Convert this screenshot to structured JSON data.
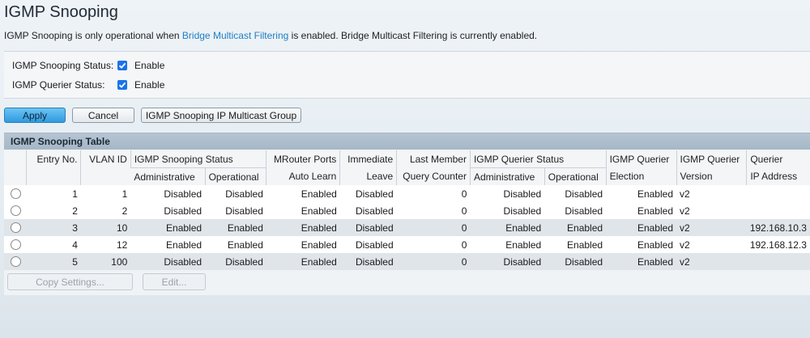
{
  "page": {
    "title": "IGMP Snooping",
    "desc_prefix": "IGMP Snooping is only operational when ",
    "desc_link": "Bridge Multicast Filtering",
    "desc_suffix": " is enabled. Bridge Multicast Filtering is currently enabled."
  },
  "status": {
    "snooping_label": "IGMP Snooping Status:",
    "snooping_checked": true,
    "snooping_text": "Enable",
    "querier_label": "IGMP Querier Status:",
    "querier_checked": true,
    "querier_text": "Enable"
  },
  "buttons": {
    "apply": "Apply",
    "cancel": "Cancel",
    "multicast_group": "IGMP Snooping IP Multicast Group",
    "copy_settings": "Copy Settings...",
    "edit": "Edit..."
  },
  "table": {
    "title": "IGMP Snooping Table",
    "headers": {
      "entry_no": "Entry No.",
      "vlan_id": "VLAN ID",
      "snooping_status": "IGMP Snooping Status",
      "administrative": "Administrative",
      "operational": "Operational",
      "mrouter_1": "MRouter Ports",
      "mrouter_2": "Auto Learn",
      "immediate_1": "Immediate",
      "immediate_2": "Leave",
      "lastmember_1": "Last Member",
      "lastmember_2": "Query Counter",
      "querier_status": "IGMP Querier Status",
      "q_administrative": "Administrative",
      "q_operational": "Operational",
      "election_1": "IGMP Querier",
      "election_2": "Election",
      "version_1": "IGMP Querier",
      "version_2": "Version",
      "ip_1": "Querier",
      "ip_2": "IP Address"
    },
    "rows": [
      {
        "entry": "1",
        "vlan": "1",
        "snoop_admin": "Disabled",
        "snoop_oper": "Disabled",
        "mrouter": "Enabled",
        "immediate": "Disabled",
        "lmqc": "0",
        "q_admin": "Disabled",
        "q_oper": "Disabled",
        "election": "Enabled",
        "version": "v2",
        "ip": ""
      },
      {
        "entry": "2",
        "vlan": "2",
        "snoop_admin": "Disabled",
        "snoop_oper": "Disabled",
        "mrouter": "Enabled",
        "immediate": "Disabled",
        "lmqc": "0",
        "q_admin": "Disabled",
        "q_oper": "Disabled",
        "election": "Enabled",
        "version": "v2",
        "ip": ""
      },
      {
        "entry": "3",
        "vlan": "10",
        "snoop_admin": "Enabled",
        "snoop_oper": "Enabled",
        "mrouter": "Enabled",
        "immediate": "Disabled",
        "lmqc": "0",
        "q_admin": "Enabled",
        "q_oper": "Enabled",
        "election": "Enabled",
        "version": "v2",
        "ip": "192.168.10.3"
      },
      {
        "entry": "4",
        "vlan": "12",
        "snoop_admin": "Enabled",
        "snoop_oper": "Enabled",
        "mrouter": "Enabled",
        "immediate": "Disabled",
        "lmqc": "0",
        "q_admin": "Enabled",
        "q_oper": "Enabled",
        "election": "Enabled",
        "version": "v2",
        "ip": "192.168.12.3"
      },
      {
        "entry": "5",
        "vlan": "100",
        "snoop_admin": "Disabled",
        "snoop_oper": "Disabled",
        "mrouter": "Enabled",
        "immediate": "Disabled",
        "lmqc": "0",
        "q_admin": "Disabled",
        "q_oper": "Disabled",
        "election": "Enabled",
        "version": "v2",
        "ip": ""
      }
    ]
  },
  "colors": {
    "accent": "#1a73e8",
    "link": "#1f7fc4",
    "primary_button": "#2f9be0"
  }
}
